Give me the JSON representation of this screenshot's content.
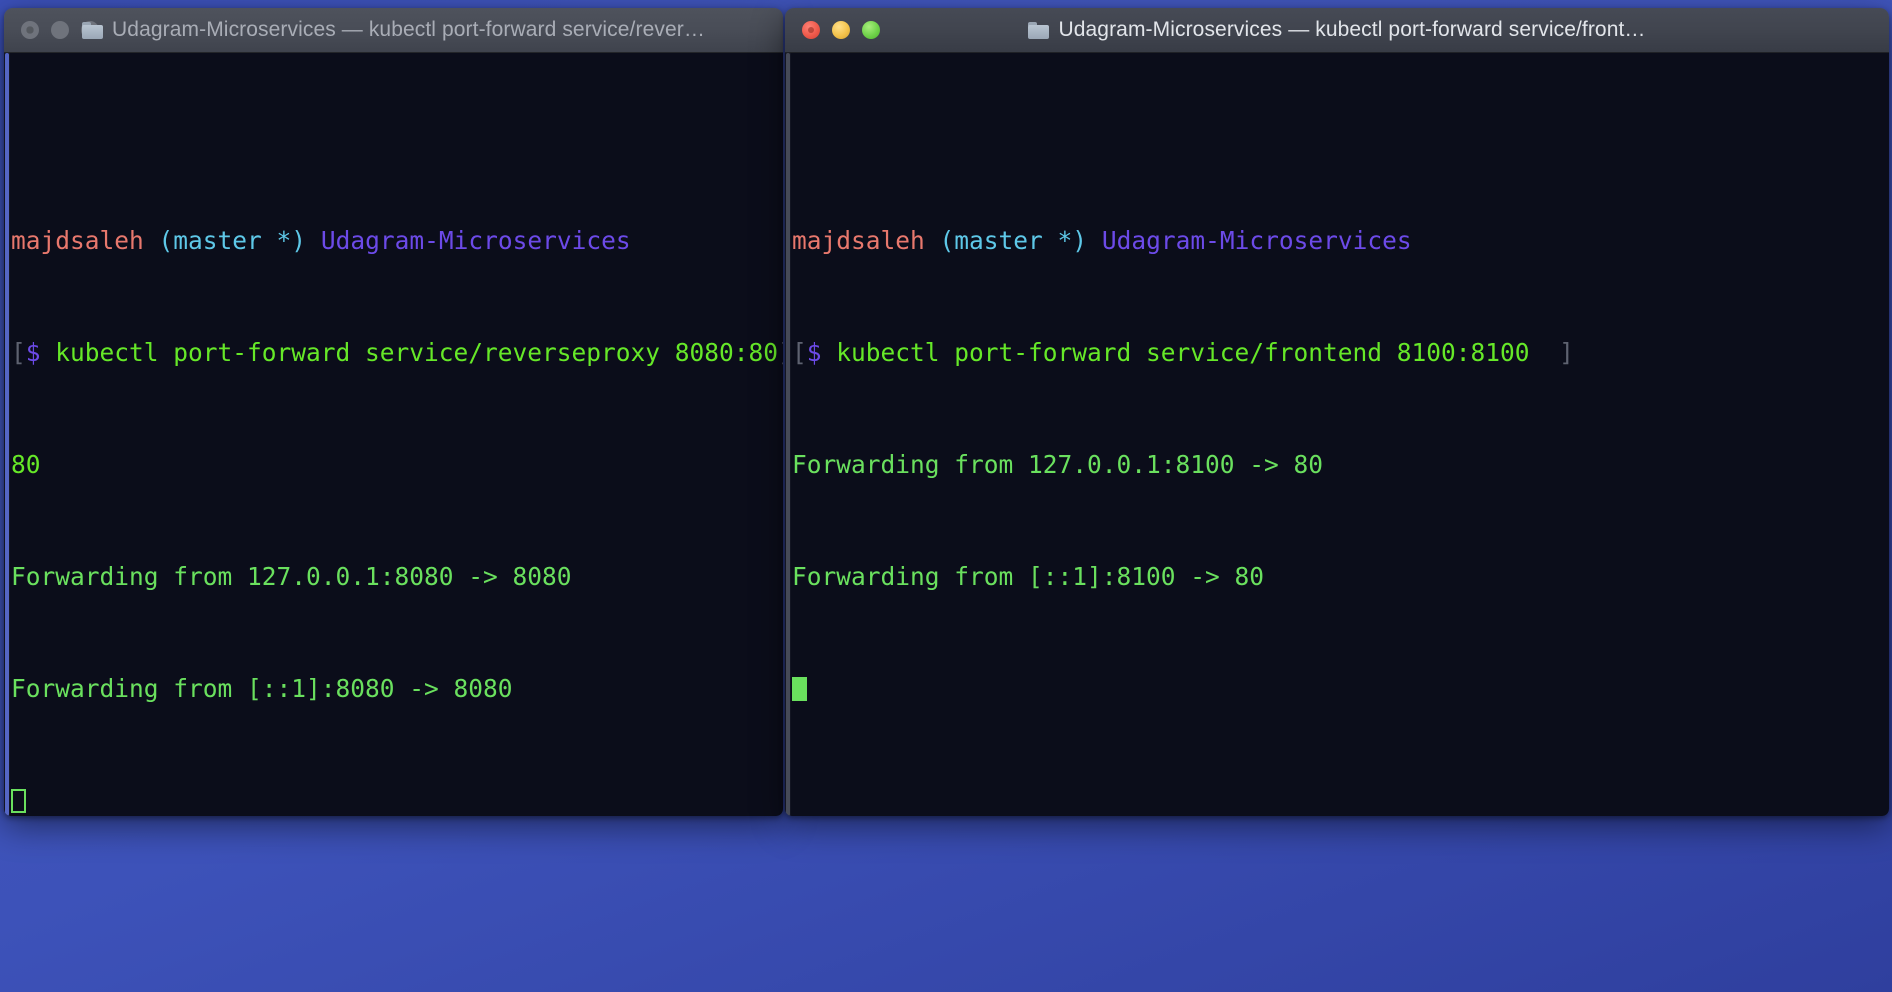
{
  "desktop": {
    "background_color": "#3d52b9"
  },
  "windows": [
    {
      "id": "left",
      "active": false,
      "title": "Udagram-Microservices — kubectl port-forward service/rever…",
      "icon": "folder-icon",
      "traffic_lights": {
        "close": "close-button",
        "minimize": "minimize-button",
        "maximize": "maximize-button"
      },
      "terminal": {
        "background_color": "#0b0d1a",
        "prompt": {
          "user": "majdsaleh",
          "branch": "(master *)",
          "path": "Udagram-Microservices",
          "symbol": "$"
        },
        "wrap_marker_left": "[",
        "wrap_marker_right": "]",
        "command": "kubectl port-forward service/reverseproxy 8080:80",
        "command_wrapped_tail": "80",
        "output": [
          "Forwarding from 127.0.0.1:8080 -> 8080",
          "Forwarding from [::1]:8080 -> 8080"
        ],
        "cursor": "hollow"
      }
    },
    {
      "id": "right",
      "active": true,
      "title": "Udagram-Microservices — kubectl port-forward service/front…",
      "icon": "folder-icon",
      "traffic_lights": {
        "close": "close-button",
        "minimize": "minimize-button",
        "maximize": "maximize-button"
      },
      "terminal": {
        "background_color": "#0b0d1a",
        "prompt": {
          "user": "majdsaleh",
          "branch": "(master *)",
          "path": "Udagram-Microservices",
          "symbol": "$"
        },
        "wrap_marker_left": "[",
        "wrap_marker_right": "]",
        "command": "kubectl port-forward service/frontend 8100:8100",
        "output": [
          "Forwarding from 127.0.0.1:8100 -> 80",
          "Forwarding from [::1]:8100 -> 80"
        ],
        "cursor": "solid"
      }
    }
  ],
  "colors": {
    "user": "#e8786d",
    "branch": "#5ec8e8",
    "path": "#6c4ae8",
    "command": "#66e828",
    "output": "#6ae05e",
    "wrap_marker": "#5e6270"
  }
}
